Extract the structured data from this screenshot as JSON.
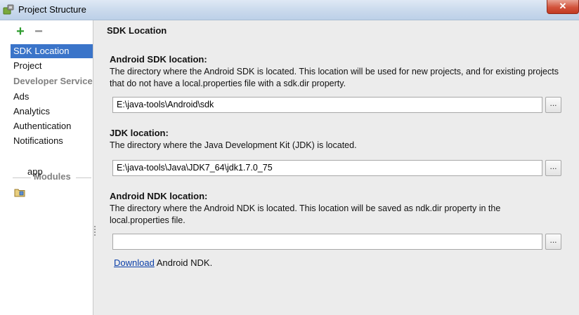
{
  "window": {
    "title": "Project Structure",
    "close_glyph": "✕",
    "icon": "android-project-structure-icon"
  },
  "sidebar": {
    "toolbar": {
      "add_glyph": "+",
      "remove_glyph": "−"
    },
    "items": [
      {
        "label": "SDK Location",
        "selected": true
      },
      {
        "label": "Project"
      }
    ],
    "developer_services": {
      "header": "Developer Services",
      "items": [
        {
          "label": "Ads"
        },
        {
          "label": "Analytics"
        },
        {
          "label": "Authentication"
        },
        {
          "label": "Notifications"
        }
      ]
    },
    "modules": {
      "header": "Modules",
      "items": [
        {
          "label": "app",
          "icon": "module-folder-icon"
        }
      ]
    }
  },
  "content": {
    "title": "SDK Location",
    "android_sdk": {
      "label": "Android SDK location:",
      "description": "The directory where the Android SDK is located. This location will be used for new projects, and for existing projects that do not have a local.properties file with a sdk.dir property.",
      "value": "E:\\java-tools\\Android\\sdk",
      "browse_label": "..."
    },
    "jdk": {
      "label": "JDK location:",
      "description": "The directory where the Java Development Kit (JDK) is located.",
      "value": "E:\\java-tools\\Java\\JDK7_64\\jdk1.7.0_75",
      "browse_label": "..."
    },
    "android_ndk": {
      "label": "Android NDK location:",
      "description": "The directory where the Android NDK is located. This location will be saved as ndk.dir property in the local.properties file.",
      "value": "",
      "browse_label": "...",
      "download_link": "Download",
      "download_suffix": " Android NDK."
    }
  },
  "colors": {
    "selection": "#3a74c9",
    "add_button": "#2e9c2e",
    "link": "#0a3ea8"
  }
}
